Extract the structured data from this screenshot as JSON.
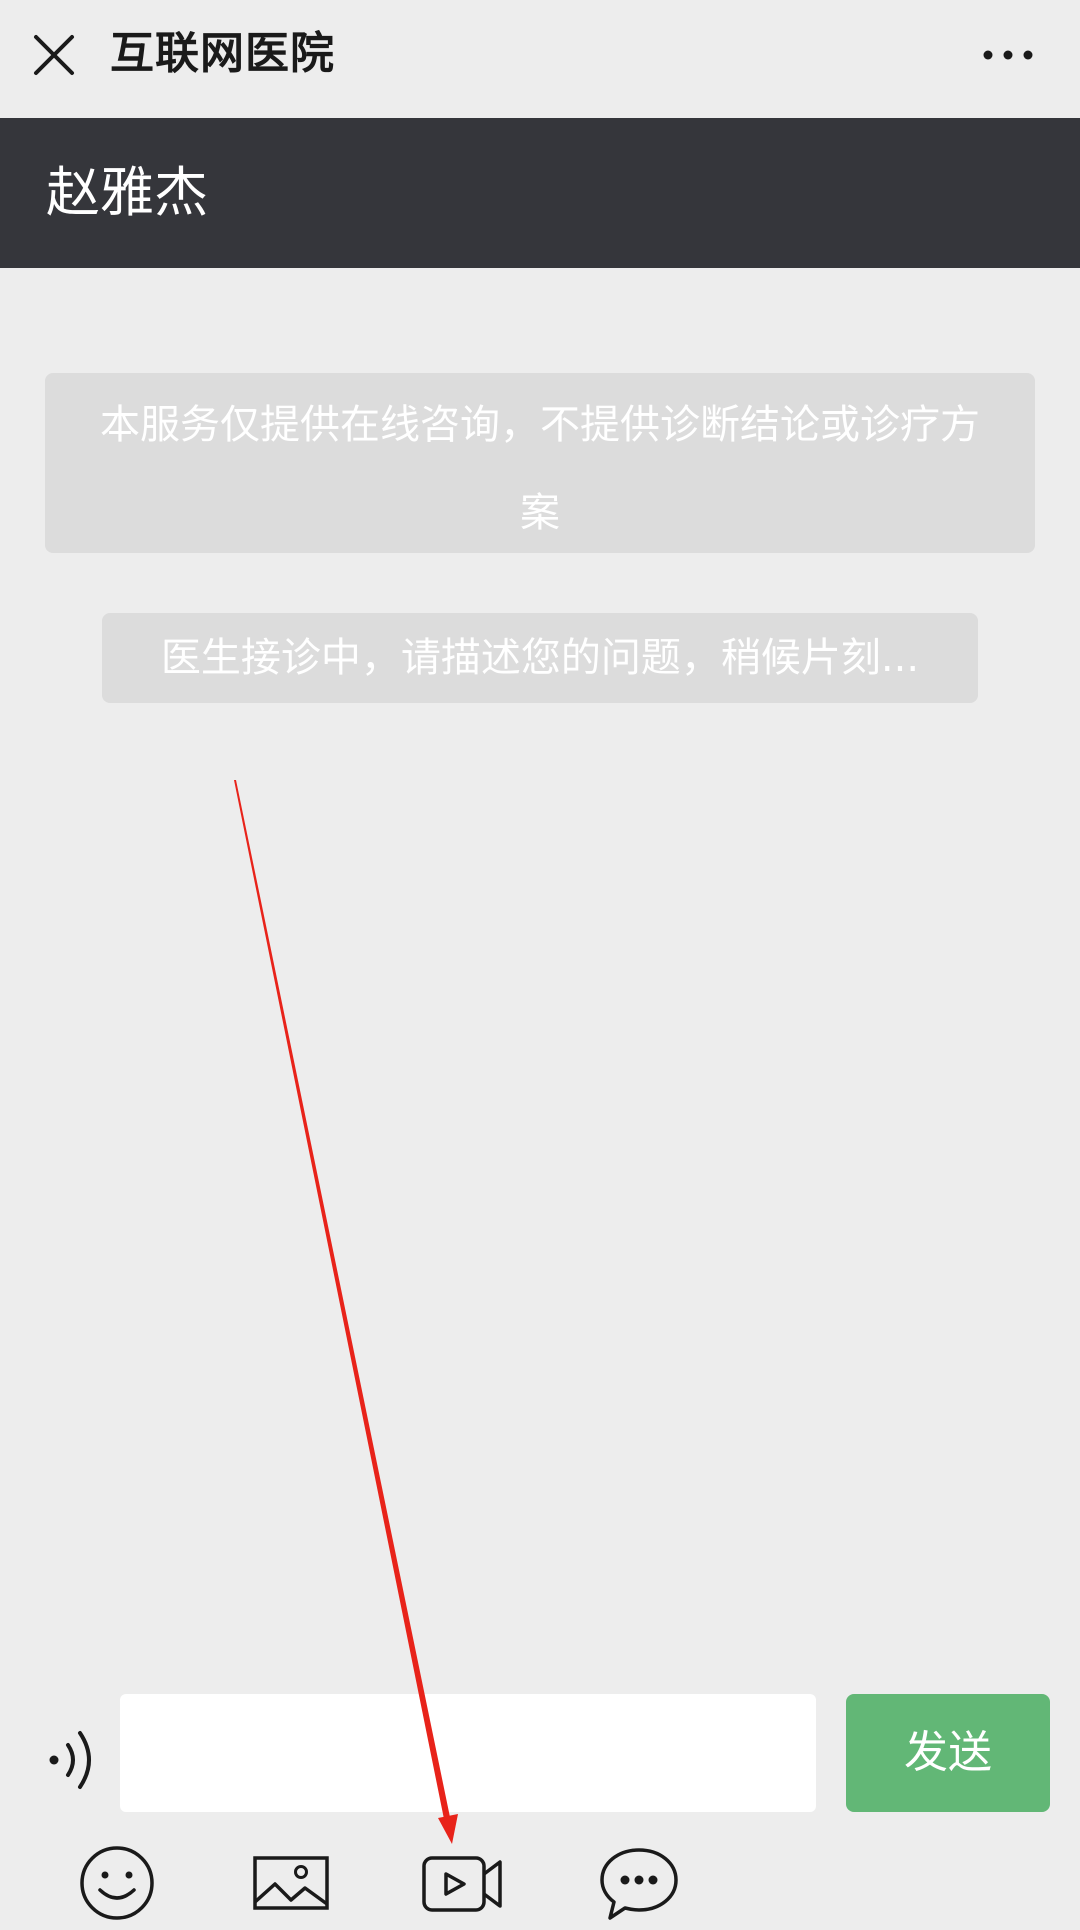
{
  "topbar": {
    "title": "互联网医院",
    "close_icon": "close-icon",
    "more_icon": "more-icon"
  },
  "doctor": {
    "name": "赵雅杰"
  },
  "chat": {
    "notice_text": "本服务仅提供在线咨询，不提供诊断结论或诊疗方案",
    "status_text": "医生接诊中，请描述您的问题，稍候片刻..."
  },
  "input_bar": {
    "voice_icon": "voice-icon",
    "message_value": "",
    "send_label": "发送",
    "tools": [
      {
        "icon": "emoji-icon"
      },
      {
        "icon": "image-icon"
      },
      {
        "icon": "video-call-icon"
      },
      {
        "icon": "chat-bubble-icon"
      }
    ]
  },
  "colors": {
    "background": "#ededed",
    "header_dark": "#35363b",
    "card_gray": "#dcdcdc",
    "send_green": "#62b776",
    "annotation_red": "#e8231a"
  }
}
